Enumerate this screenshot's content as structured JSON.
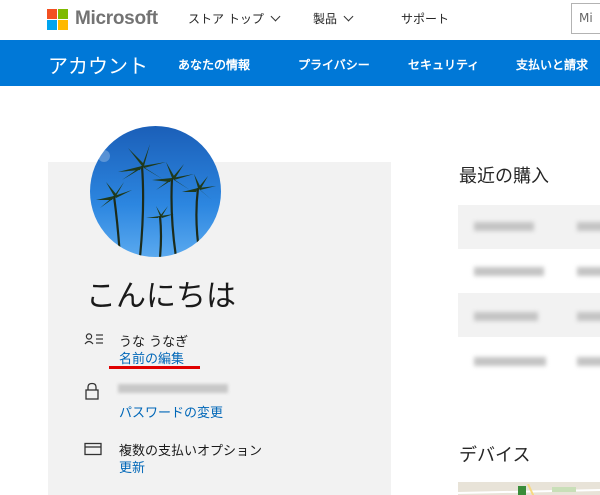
{
  "topbar": {
    "brand": "Microsoft",
    "nav": [
      {
        "label": "ストア トップ",
        "has_dropdown": true
      },
      {
        "label": "製品",
        "has_dropdown": true
      },
      {
        "label": "サポート",
        "has_dropdown": false
      }
    ],
    "search_partial": "Mi"
  },
  "account_bar": {
    "title": "アカウント",
    "links": [
      "あなたの情報",
      "プライバシー",
      "セキュリティ",
      "支払いと請求"
    ]
  },
  "profile": {
    "greeting": "こんにちは",
    "name": "うな うなぎ",
    "edit_name": "名前の編集",
    "change_password": "パスワードの変更",
    "payment_options": "複数の支払いオプション",
    "update": "更新"
  },
  "right": {
    "recent_purchases": "最近の購入",
    "devices": "デバイス"
  },
  "colors": {
    "accent": "#0078d7",
    "link": "#0067b8",
    "highlight": "#e00000",
    "ms_red": "#f25022",
    "ms_green": "#7fba00",
    "ms_blue": "#00a4ef",
    "ms_yellow": "#ffb900"
  }
}
